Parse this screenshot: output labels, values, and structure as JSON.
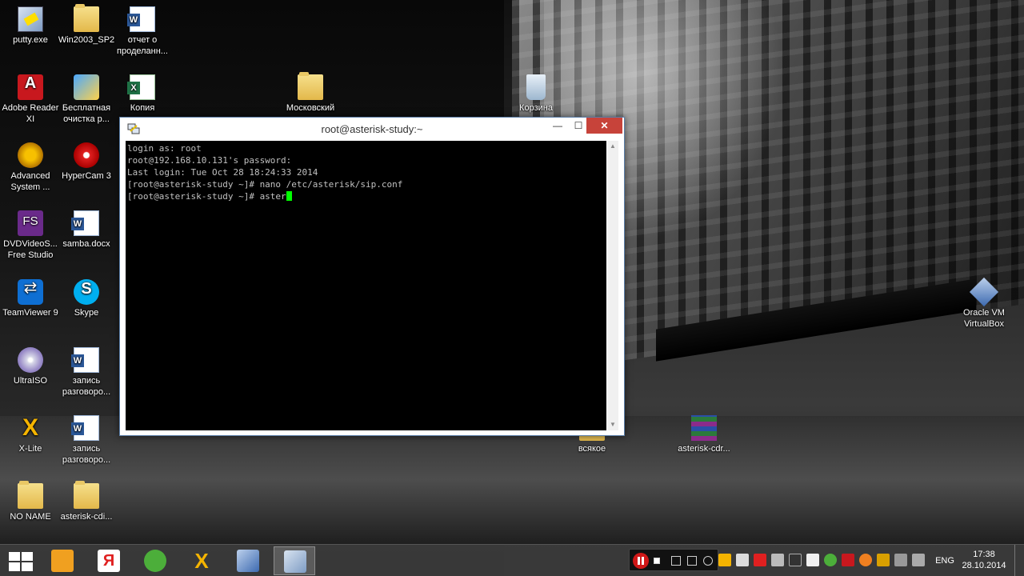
{
  "desktop": {
    "icons": [
      {
        "label": "putty.exe",
        "icon": "putty-icon"
      },
      {
        "label": "Win2003_SP2",
        "icon": "folder-icon"
      },
      {
        "label": "отчет о проделанн...",
        "icon": "word-doc-icon"
      },
      {
        "label": "Adobe Reader XI",
        "icon": "pdf-icon"
      },
      {
        "label": "Бесплатная очистка р...",
        "icon": "cleaner-icon"
      },
      {
        "label": "Копия",
        "icon": "excel-doc-icon"
      },
      {
        "label": "Московский",
        "icon": "folder-icon"
      },
      {
        "label": "Корзина",
        "icon": "recycle-bin-icon"
      },
      {
        "label": "Advanced System ...",
        "icon": "shield-icon"
      },
      {
        "label": "HyperCam 3",
        "icon": "hypercam-icon"
      },
      {
        "label": "DVDVideoS... Free Studio",
        "icon": "freestudio-icon"
      },
      {
        "label": "samba.docx",
        "icon": "word-doc-icon"
      },
      {
        "label": "TeamViewer 9",
        "icon": "teamviewer-icon"
      },
      {
        "label": "Skype",
        "icon": "skype-icon"
      },
      {
        "label": "Oracle VM VirtualBox",
        "icon": "virtualbox-icon"
      },
      {
        "label": "UltraISO",
        "icon": "ultraiso-icon"
      },
      {
        "label": "запись разговоро...",
        "icon": "word-doc-icon"
      },
      {
        "label": "X-Lite",
        "icon": "xlite-icon"
      },
      {
        "label": "запись разговоро...",
        "icon": "word-doc-icon"
      },
      {
        "label": "всякое",
        "icon": "folder-icon"
      },
      {
        "label": "asterisk-cdr...",
        "icon": "winrar-icon"
      },
      {
        "label": "NO NAME",
        "icon": "folder-icon"
      },
      {
        "label": "asterisk-cdi...",
        "icon": "folder-icon"
      }
    ]
  },
  "window": {
    "title": "root@asterisk-study:~",
    "buttons": {
      "minimize": "—",
      "maximize": "☐",
      "close": "✕"
    },
    "terminal_lines": [
      "login as: root",
      "root@192.168.10.131's password:",
      "Last login: Tue Oct 28 18:24:33 2014",
      "[root@asterisk-study ~]# nano /etc/asterisk/sip.conf",
      "[root@asterisk-study ~]# aster"
    ]
  },
  "taskbar": {
    "apps": [
      "start-icon",
      "outlook-icon",
      "yandex-icon",
      "utorrent-icon",
      "xlite-icon",
      "virtualbox-icon",
      "putty-icon"
    ],
    "language": "ENG",
    "time": "17:38",
    "date": "28.10.2014"
  },
  "colors": {
    "cursor": "#00ff00",
    "close_button": "#c7433a",
    "terminal_bg": "#000000",
    "terminal_fg": "#c0c0c0"
  }
}
